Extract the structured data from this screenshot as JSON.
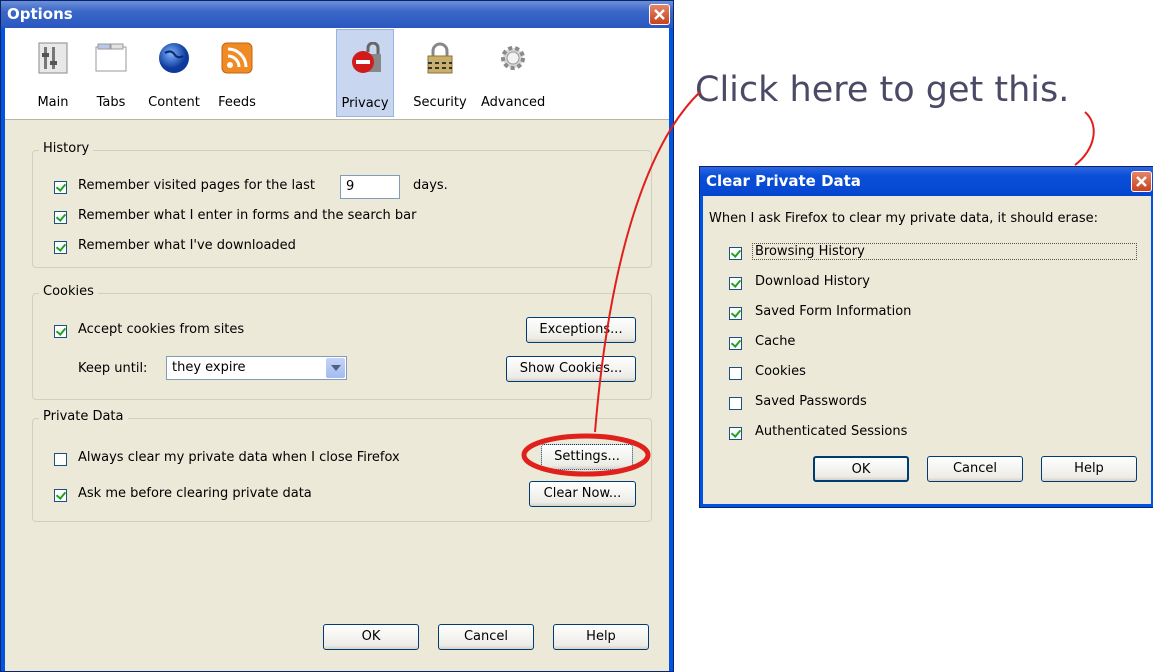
{
  "options": {
    "title": "Options",
    "panes": [
      {
        "label": "Main",
        "icon": "main-icon"
      },
      {
        "label": "Tabs",
        "icon": "tabs-icon"
      },
      {
        "label": "Content",
        "icon": "globe-icon"
      },
      {
        "label": "Feeds",
        "icon": "rss-icon"
      },
      {
        "label": "Privacy",
        "icon": "lock-sign-icon",
        "selected": true
      },
      {
        "label": "Security",
        "icon": "padlock-icon"
      },
      {
        "label": "Advanced",
        "icon": "gear-icon"
      }
    ],
    "history": {
      "legend": "History",
      "remember_visited_prefix": "Remember visited pages for the last",
      "days_value": "9",
      "days_suffix": "days.",
      "remember_forms": "Remember what I enter in forms and the search bar",
      "remember_downloads": "Remember what I've downloaded"
    },
    "cookies": {
      "legend": "Cookies",
      "accept": "Accept cookies from sites",
      "exceptions_button": "Exceptions...",
      "keep_until_label": "Keep until:",
      "keep_until_value": "they expire",
      "show_cookies_button": "Show Cookies..."
    },
    "private_data": {
      "legend": "Private Data",
      "always_clear": "Always clear my private data when I close Firefox",
      "settings_button": "Settings...",
      "ask_me": "Ask me before clearing private data",
      "clear_now_button": "Clear Now..."
    },
    "ok_button": "OK",
    "cancel_button": "Cancel",
    "help_button": "Help"
  },
  "annotation": {
    "text": "Click here to get this.",
    "color": "#e0201c"
  },
  "clear_dialog": {
    "title": "Clear Private Data",
    "intro": "When I ask Firefox to clear my private data, it should erase:",
    "items": [
      {
        "label": "Browsing History",
        "checked": true
      },
      {
        "label": "Download History",
        "checked": true
      },
      {
        "label": "Saved Form Information",
        "checked": true
      },
      {
        "label": "Cache",
        "checked": true
      },
      {
        "label": "Cookies",
        "checked": false
      },
      {
        "label": "Saved Passwords",
        "checked": false
      },
      {
        "label": "Authenticated Sessions",
        "checked": true
      }
    ],
    "ok_button": "OK",
    "cancel_button": "Cancel",
    "help_button": "Help"
  }
}
